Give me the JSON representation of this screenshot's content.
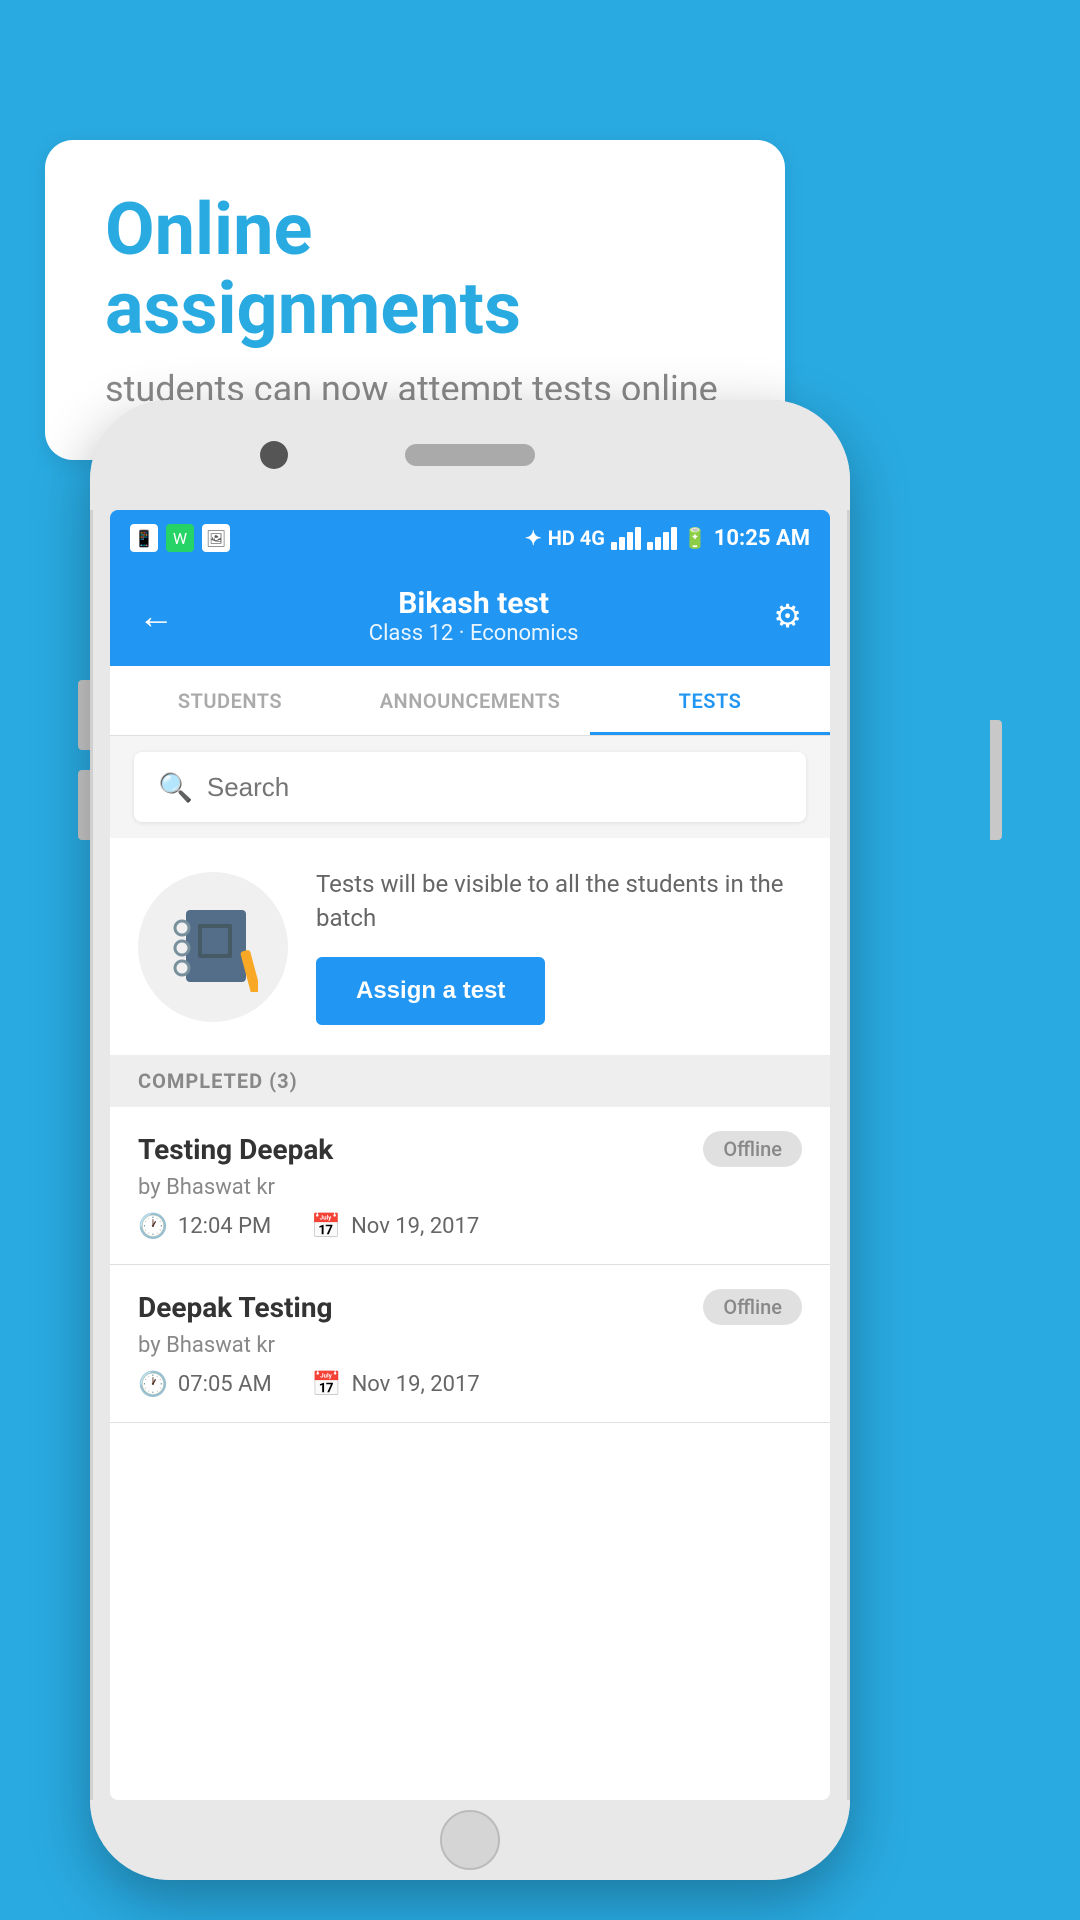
{
  "background_color": "#29ABE2",
  "bubble": {
    "title": "Online assignments",
    "subtitle": "students can now attempt tests online"
  },
  "status_bar": {
    "time": "10:25 AM",
    "network": "HD 4G"
  },
  "app_bar": {
    "title": "Bikash test",
    "subtitle": "Class 12 · Economics",
    "back_label": "←",
    "settings_label": "⚙"
  },
  "tabs": [
    {
      "label": "STUDENTS",
      "active": false
    },
    {
      "label": "ANNOUNCEMENTS",
      "active": false
    },
    {
      "label": "TESTS",
      "active": true
    }
  ],
  "search": {
    "placeholder": "Search"
  },
  "assign_section": {
    "info_text": "Tests will be visible to all the students in the batch",
    "button_label": "Assign a test"
  },
  "completed_section": {
    "header": "COMPLETED (3)",
    "items": [
      {
        "name": "Testing Deepak",
        "author": "by Bhaswat kr",
        "time": "12:04 PM",
        "date": "Nov 19, 2017",
        "status": "Offline"
      },
      {
        "name": "Deepak Testing",
        "author": "by Bhaswat kr",
        "time": "07:05 AM",
        "date": "Nov 19, 2017",
        "status": "Offline"
      }
    ]
  }
}
